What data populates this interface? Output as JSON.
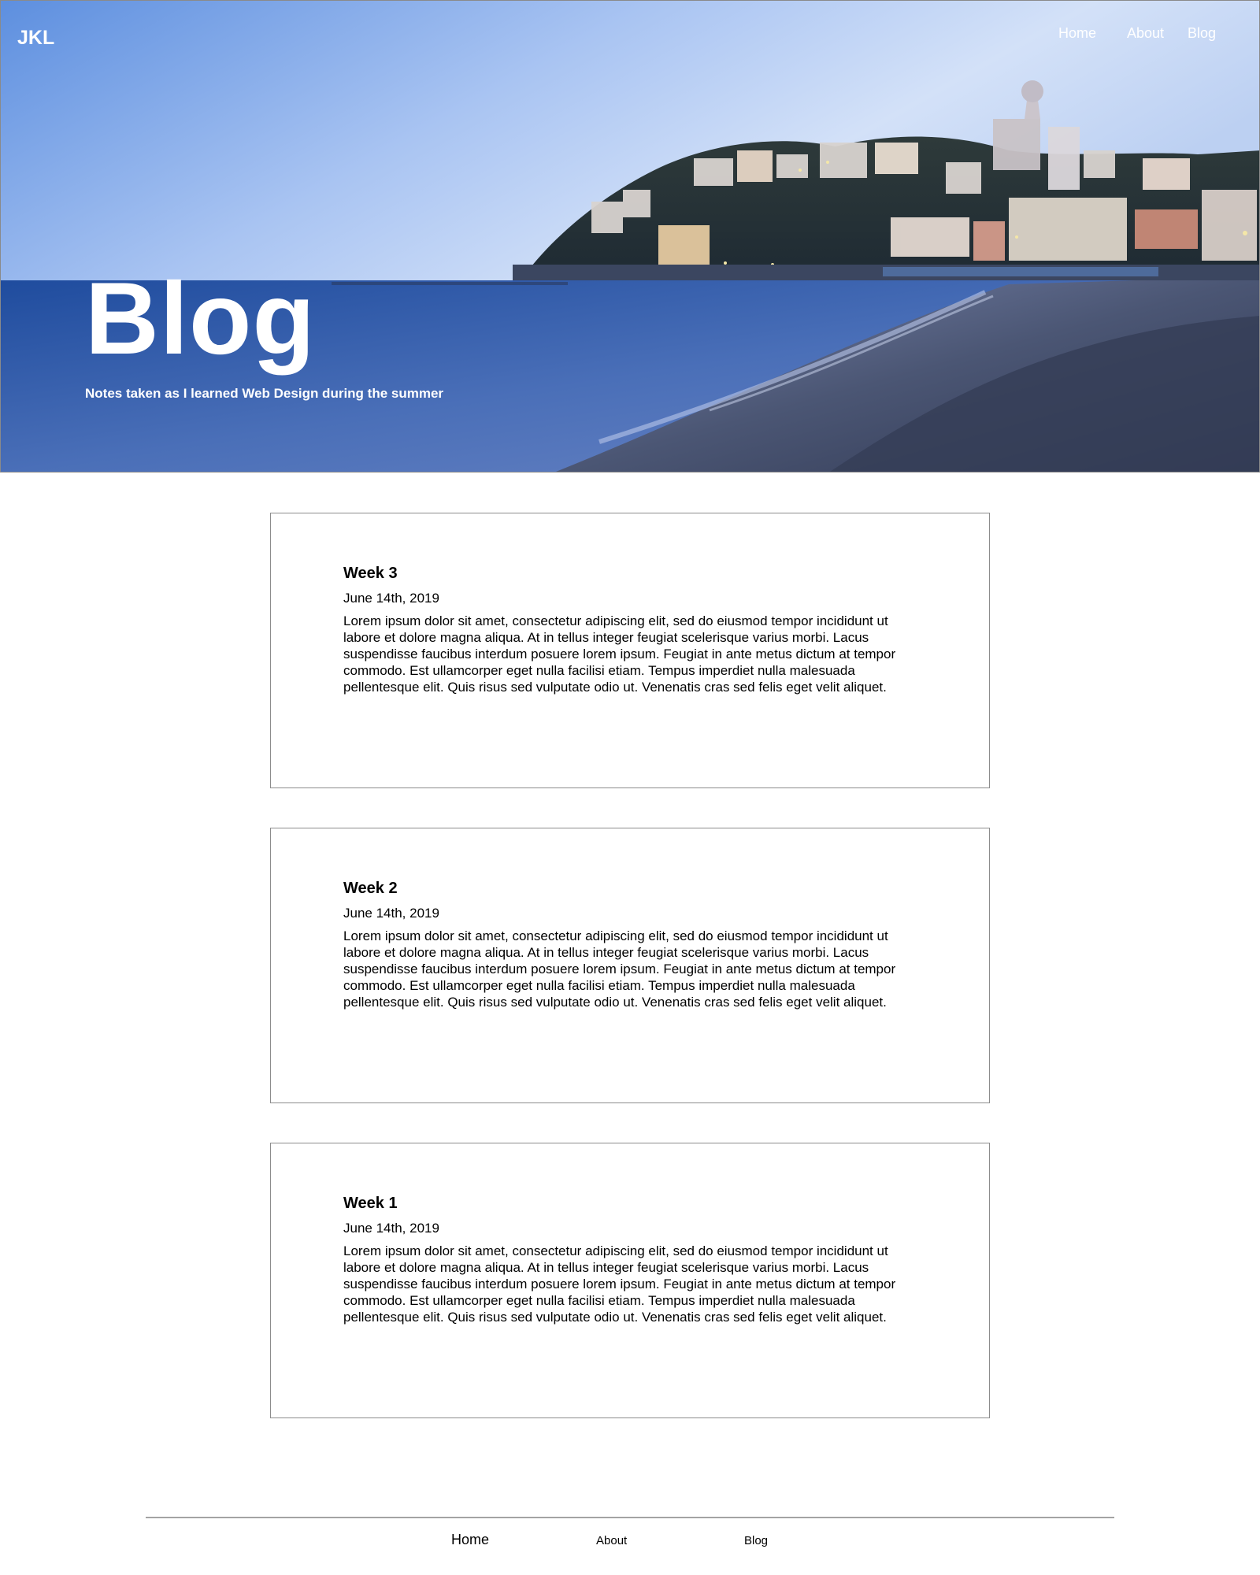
{
  "header": {
    "logo": "JKL",
    "nav": [
      {
        "label": "Home"
      },
      {
        "label": "About"
      },
      {
        "label": "Blog"
      }
    ]
  },
  "hero": {
    "title": "Blog",
    "subtitle": "Notes taken as I learned Web Design during the summer",
    "image_description_colors": {
      "sky_top": "#6f9ee6",
      "sky_bottom": "#c9dbf7",
      "sea": "#2f5aa8",
      "sand": "#4d5670"
    }
  },
  "posts": [
    {
      "title": "Week 3",
      "date": "June 14th, 2019",
      "body": "Lorem ipsum dolor sit amet, consectetur adipiscing elit, sed do eiusmod tempor incididunt ut labore et dolore magna aliqua. At in tellus integer feugiat scelerisque varius morbi. Lacus suspendisse faucibus interdum posuere lorem ipsum. Feugiat in ante metus dictum at tempor commodo. Est ullamcorper eget nulla facilisi etiam. Tempus imperdiet nulla malesuada pellentesque elit. Quis risus sed vulputate odio ut. Venenatis cras sed felis eget velit aliquet."
    },
    {
      "title": "Week 2",
      "date": "June 14th, 2019",
      "body": "Lorem ipsum dolor sit amet, consectetur adipiscing elit, sed do eiusmod tempor incididunt ut labore et dolore magna aliqua. At in tellus integer feugiat scelerisque varius morbi. Lacus suspendisse faucibus interdum posuere lorem ipsum. Feugiat in ante metus dictum at tempor commodo. Est ullamcorper eget nulla facilisi etiam. Tempus imperdiet nulla malesuada pellentesque elit. Quis risus sed vulputate odio ut. Venenatis cras sed felis eget velit aliquet."
    },
    {
      "title": "Week 1",
      "date": "June 14th, 2019",
      "body": "Lorem ipsum dolor sit amet, consectetur adipiscing elit, sed do eiusmod tempor incididunt ut labore et dolore magna aliqua. At in tellus integer feugiat scelerisque varius morbi. Lacus suspendisse faucibus interdum posuere lorem ipsum. Feugiat in ante metus dictum at tempor commodo. Est ullamcorper eget nulla facilisi etiam. Tempus imperdiet nulla malesuada pellentesque elit. Quis risus sed vulputate odio ut. Venenatis cras sed felis eget velit aliquet."
    }
  ],
  "footer": {
    "nav": [
      {
        "label": "Home"
      },
      {
        "label": "About"
      },
      {
        "label": "Blog"
      }
    ]
  }
}
